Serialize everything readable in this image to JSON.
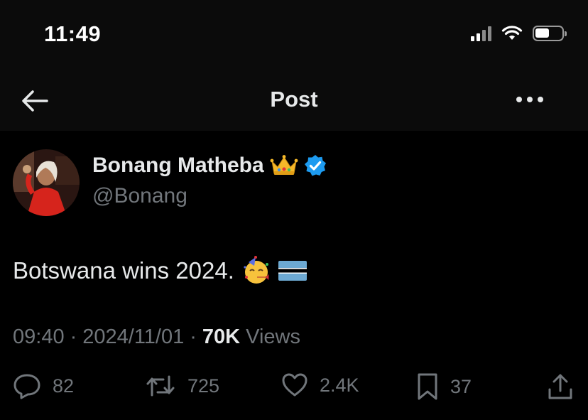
{
  "status_bar": {
    "time": "11:49",
    "icons": [
      "cellular-signal-icon",
      "wifi-icon",
      "battery-icon"
    ]
  },
  "nav": {
    "title": "Post",
    "back_icon": "arrow-left-icon",
    "more_icon": "more-horizontal-icon"
  },
  "post": {
    "author_name": "Bonang Matheba",
    "author_badge_icons": [
      "crown-emoji-icon",
      "verified-badge-icon"
    ],
    "handle": "@Bonang",
    "text": "Botswana wins 2024.",
    "text_emoji_icons": [
      "partying-face-emoji-icon",
      "botswana-flag-icon"
    ],
    "time": "09:40",
    "separator": "·",
    "date": "2024/11/01",
    "views_count": "70K",
    "views_label": "Views"
  },
  "actions": {
    "replies": "82",
    "reposts": "725",
    "likes": "2.4K",
    "bookmarks": "37",
    "icons": [
      "reply-icon",
      "repost-icon",
      "like-icon",
      "bookmark-icon",
      "share-icon"
    ]
  },
  "colors": {
    "background": "#000000",
    "text_primary": "#e7e9ea",
    "text_secondary": "#71767b",
    "verified_blue": "#1d9bf0",
    "header_bg": "#0b0b0b"
  }
}
